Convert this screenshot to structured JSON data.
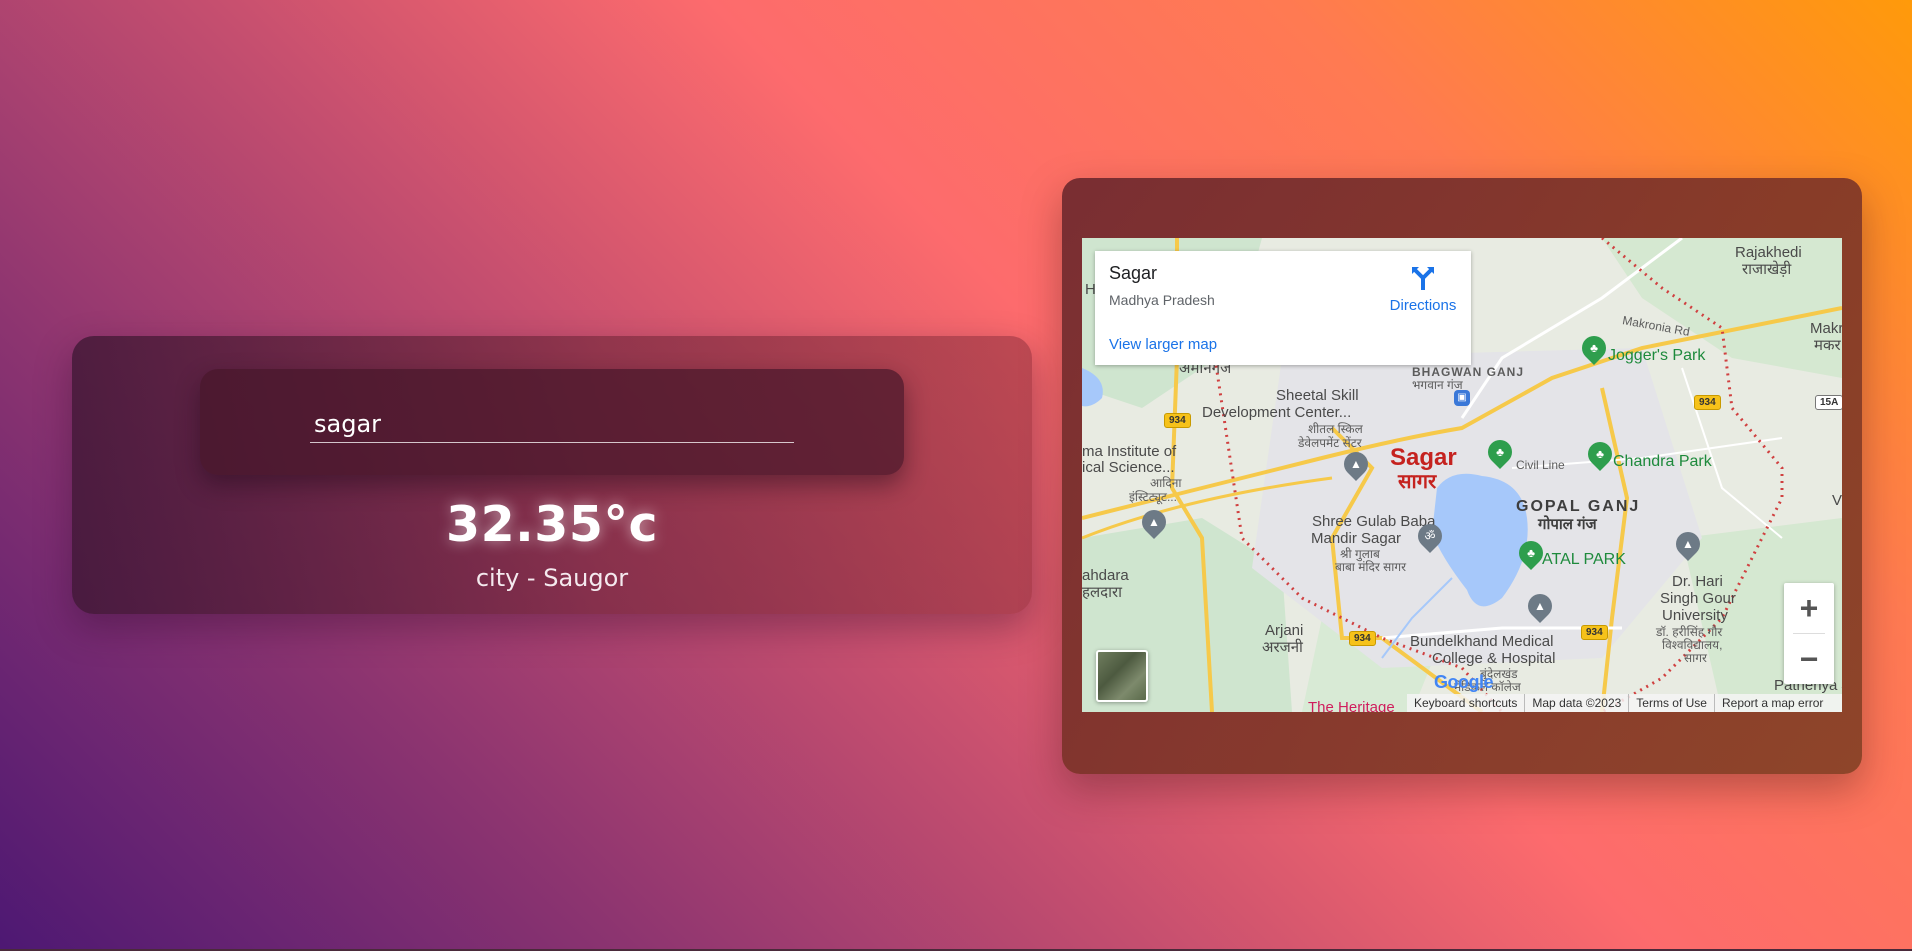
{
  "weather": {
    "search_value": "sagar",
    "temperature": "32.35°c",
    "city_line": "city - Saugor"
  },
  "map": {
    "info_window": {
      "place_name": "Sagar",
      "region": "Madhya Pradesh",
      "directions_label": "Directions",
      "view_larger_label": "View larger map"
    },
    "labels": {
      "sagar": "Sagar",
      "sagar_hi": "सागर",
      "joggers_park": "Jogger's Park",
      "chandra_park": "Chandra Park",
      "atal_park": "ATAL PARK",
      "gopal_ganj": "GOPAL GANJ",
      "gopal_ganj_hi": "गोपाल गंज",
      "bhagwan_ganj": "BHAGWAN GANJ",
      "bhagwan_ganj_hi": "भगवान गंज",
      "sheetal_skill": "Sheetal Skill",
      "development_center": "Development Center...",
      "sheetal_hi_1": "शीतल स्किल",
      "sheetal_hi_2": "डेवेलपमेंट सेंटर",
      "shree_gulab_baba": "Shree Gulab Baba",
      "mandir_sagar": "Mandir Sagar",
      "gulab_hi_1": "श्री गुलाब",
      "gulab_hi_2": "बाबा मंदिर सागर",
      "bundelkhand_1": "Bundelkhand Medical",
      "bundelkhand_2": "College & Hospital",
      "bundelkhand_hi_1": "बुंदेलखंड",
      "bundelkhand_hi_2": "मेडिकल कॉलेज",
      "dr_hari_1": "Dr. Hari",
      "dr_hari_2": "Singh Gour",
      "dr_hari_3": "University",
      "dr_hari_hi_1": "डॉ. हरीसिंह गौर",
      "dr_hari_hi_2": "विश्वविद्यालय,",
      "dr_hari_hi_3": "सागर",
      "rajakhedi": "Rajakhedi",
      "rajakhedi_hi": "राजाखेड़ी",
      "makronia_rd": "Makronia Rd",
      "makr": "Makr",
      "makr_hi": "मकर",
      "civil_line": "Civil Line",
      "arjani": "Arjani",
      "arjani_hi": "अरजनी",
      "patheriya_jat": "Patheriya Jat",
      "heritage": "The Heritage",
      "ahdara": "ahdara",
      "ahdara_hi": "हलदारा",
      "institute_1": "ma Institute of",
      "institute_2": "ical Science...",
      "institute_hi_1": "आदिना",
      "institute_hi_2": "इंस्टिट्यूट...",
      "amanganj": "अमानगंज",
      "route_934": "934",
      "route_15a": "15A",
      "edge_h": "H",
      "edge_v": "V"
    },
    "zoom_in_label": "+",
    "zoom_out_label": "−",
    "google_logo": "Google",
    "footer": {
      "shortcuts": "Keyboard shortcuts",
      "map_data": "Map data ©2023",
      "terms": "Terms of Use",
      "report": "Report a map error"
    }
  }
}
